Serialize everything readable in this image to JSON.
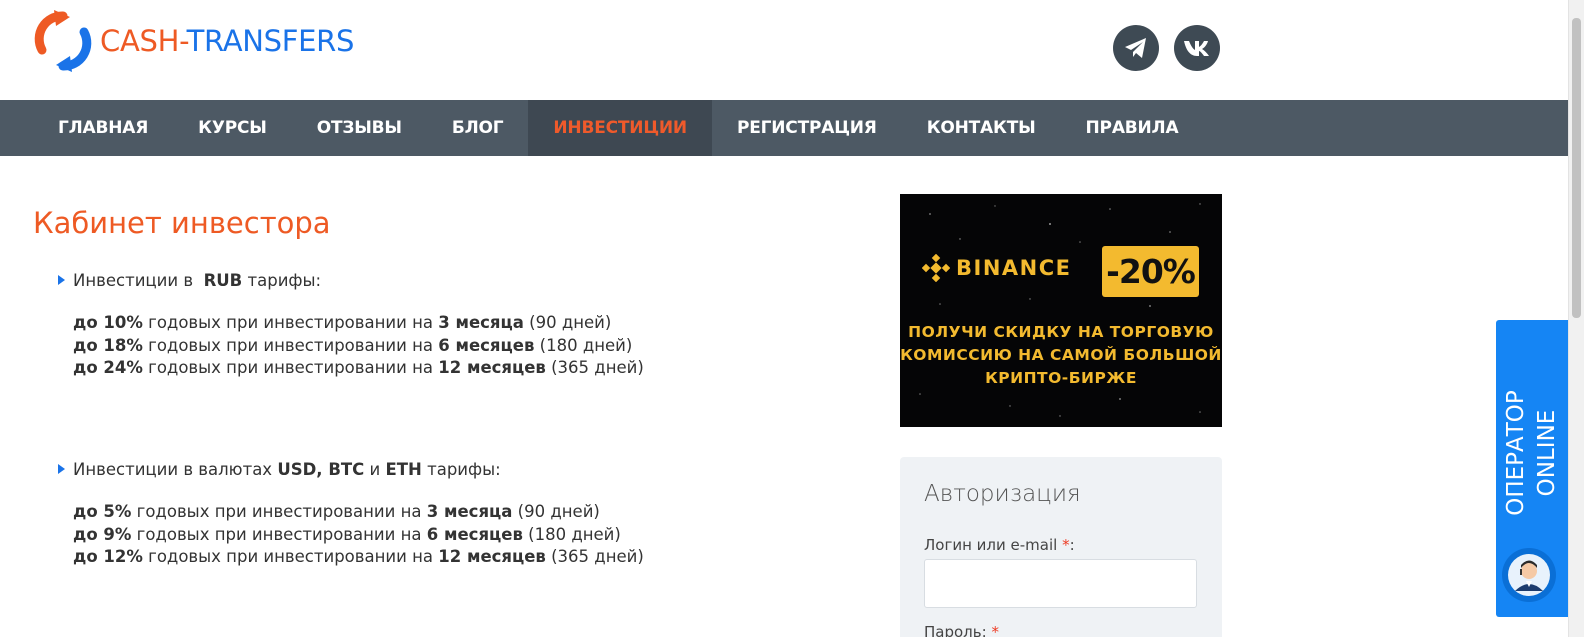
{
  "header": {
    "logo_part1": "CASH",
    "logo_sep": "-",
    "logo_part2": "TRANSFERS",
    "social": [
      {
        "name": "telegram",
        "icon": "telegram-icon"
      },
      {
        "name": "vkontakte",
        "icon": "vk-icon"
      }
    ]
  },
  "nav": {
    "items": [
      {
        "label": "ГЛАВНАЯ",
        "active": false
      },
      {
        "label": "КУРСЫ",
        "active": false
      },
      {
        "label": "ОТЗЫВЫ",
        "active": false
      },
      {
        "label": "БЛОГ",
        "active": false
      },
      {
        "label": "ИНВЕСТИЦИИ",
        "active": true
      },
      {
        "label": "РЕГИСТРАЦИЯ",
        "active": false
      },
      {
        "label": "КОНТАКТЫ",
        "active": false
      },
      {
        "label": "ПРАВИЛА",
        "active": false
      }
    ]
  },
  "main": {
    "title": "Кабинет инвестора",
    "rub": {
      "lead_prefix": "Инвестиции в",
      "lead_currency": "RUB",
      "lead_suffix": "тарифы:",
      "rates": [
        {
          "rate": "до 10%",
          "middle": "годовых при инвестировании на",
          "term": "3 месяца",
          "days": "(90 дней)"
        },
        {
          "rate": "до 18%",
          "middle": "годовых при инвестировании на",
          "term": "6 месяцев",
          "days": "(180 дней)"
        },
        {
          "rate": "до 24%",
          "middle": "годовых при инвестировании на",
          "term": "12 месяцев",
          "days": "(365 дней)"
        }
      ]
    },
    "crypto": {
      "lead_prefix": "Инвестиции в валютах",
      "lead_currencies": "USD, BTC",
      "lead_and": "и",
      "lead_last": "ETH",
      "lead_suffix": "тарифы:",
      "rates": [
        {
          "rate": "до 5%",
          "middle": "годовых при инвестировании на",
          "term": "3 месяца",
          "days": "(90 дней)"
        },
        {
          "rate": "до 9%",
          "middle": "годовых при инвестировании на",
          "term": "6 месяцев",
          "days": "(180 дней)"
        },
        {
          "rate": "до 12%",
          "middle": "годовых при инвестировании на",
          "term": "12 месяцев",
          "days": "(365 дней)"
        }
      ]
    }
  },
  "ad": {
    "brand": "BINANCE",
    "discount": "-20%",
    "line1": "ПОЛУЧИ СКИДКУ НА ТОРГОВУЮ",
    "line2": "КОМИССИЮ НА САМОЙ БОЛЬШОЙ",
    "line3": "КРИПТО-БИРЖЕ"
  },
  "auth": {
    "title": "Авторизация",
    "login_label": "Логин или e-mail",
    "password_label": "Пароль:",
    "required_mark": "*",
    "login_value": ""
  },
  "operator": {
    "line1": "ОПЕРАТОР",
    "line2": "ONLINE"
  },
  "colors": {
    "brand_orange": "#ee5a24",
    "brand_blue": "#1a73e8",
    "nav_bg": "#4d5964",
    "nav_active_text": "#ef5a2b",
    "binance_yellow": "#f3ba2f",
    "widget_blue": "#1585f4"
  }
}
